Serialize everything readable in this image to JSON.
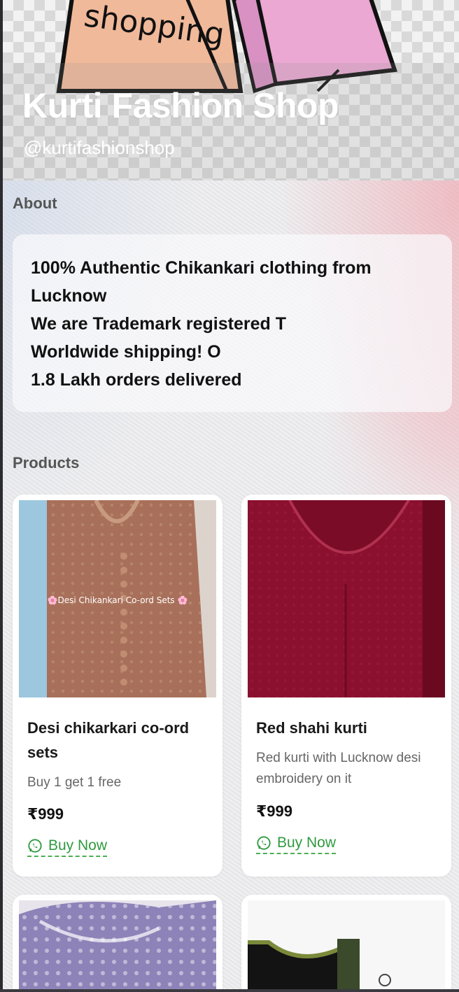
{
  "header": {
    "bag_text": "shopping",
    "title": "Kurti Fashion Shop",
    "handle": "@kurtifashionshop"
  },
  "about": {
    "heading": "About",
    "lines": [
      "100% Authentic Chikankari clothing from",
      "Lucknow",
      "We are Trademark registered T",
      "Worldwide shipping! O",
      "1.8 Lakh orders delivered"
    ]
  },
  "products": {
    "heading": "Products",
    "items": [
      {
        "name": "Desi chikarkari co-ord sets",
        "image_caption": "🌸Desi Chikankari Co-ord Sets 🌸",
        "description": "Buy 1 get 1 free",
        "price": "₹999",
        "cta": "Buy Now"
      },
      {
        "name": "Red shahi kurti",
        "description": "Red kurti with Lucknow desi embroidery on it",
        "price": "₹999",
        "cta": "Buy Now"
      }
    ]
  },
  "icons": [
    "whatsapp-icon"
  ],
  "colors": {
    "accent_green": "#2f9a3f",
    "text_dark": "#111111",
    "muted": "#666666"
  }
}
